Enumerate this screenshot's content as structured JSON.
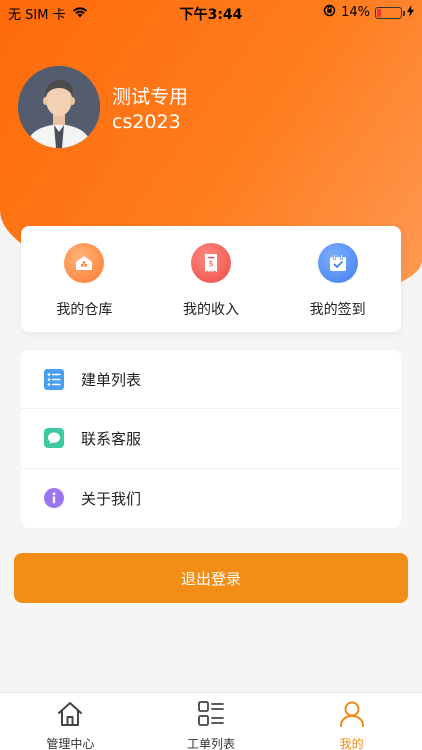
{
  "status_bar": {
    "carrier": "无 SIM 卡",
    "time": "下午3:44",
    "battery_percent": "14%",
    "battery_level": 0.14
  },
  "profile": {
    "name": "测试专用",
    "id": "cs2023"
  },
  "quick_actions": [
    {
      "label": "我的仓库",
      "icon": "warehouse-icon",
      "color": "#ff8a3d"
    },
    {
      "label": "我的收入",
      "icon": "income-icon",
      "color": "#f05a50"
    },
    {
      "label": "我的签到",
      "icon": "checkin-icon",
      "color": "#4a86f0"
    }
  ],
  "menu": [
    {
      "label": "建单列表",
      "icon": "list-icon",
      "color": "#3d8ee8"
    },
    {
      "label": "联系客服",
      "icon": "chat-icon",
      "color": "#3ec9a0"
    },
    {
      "label": "关于我们",
      "icon": "info-icon",
      "color": "#8f6df0"
    }
  ],
  "logout_label": "退出登录",
  "tabs": [
    {
      "label": "管理中心",
      "icon": "home-icon",
      "active": false
    },
    {
      "label": "工单列表",
      "icon": "grid-list-icon",
      "active": false
    },
    {
      "label": "我的",
      "icon": "user-icon",
      "active": true
    }
  ],
  "colors": {
    "brand_orange": "#ff7a1a",
    "button_orange": "#f28d16",
    "active_tab": "#f08a12"
  }
}
